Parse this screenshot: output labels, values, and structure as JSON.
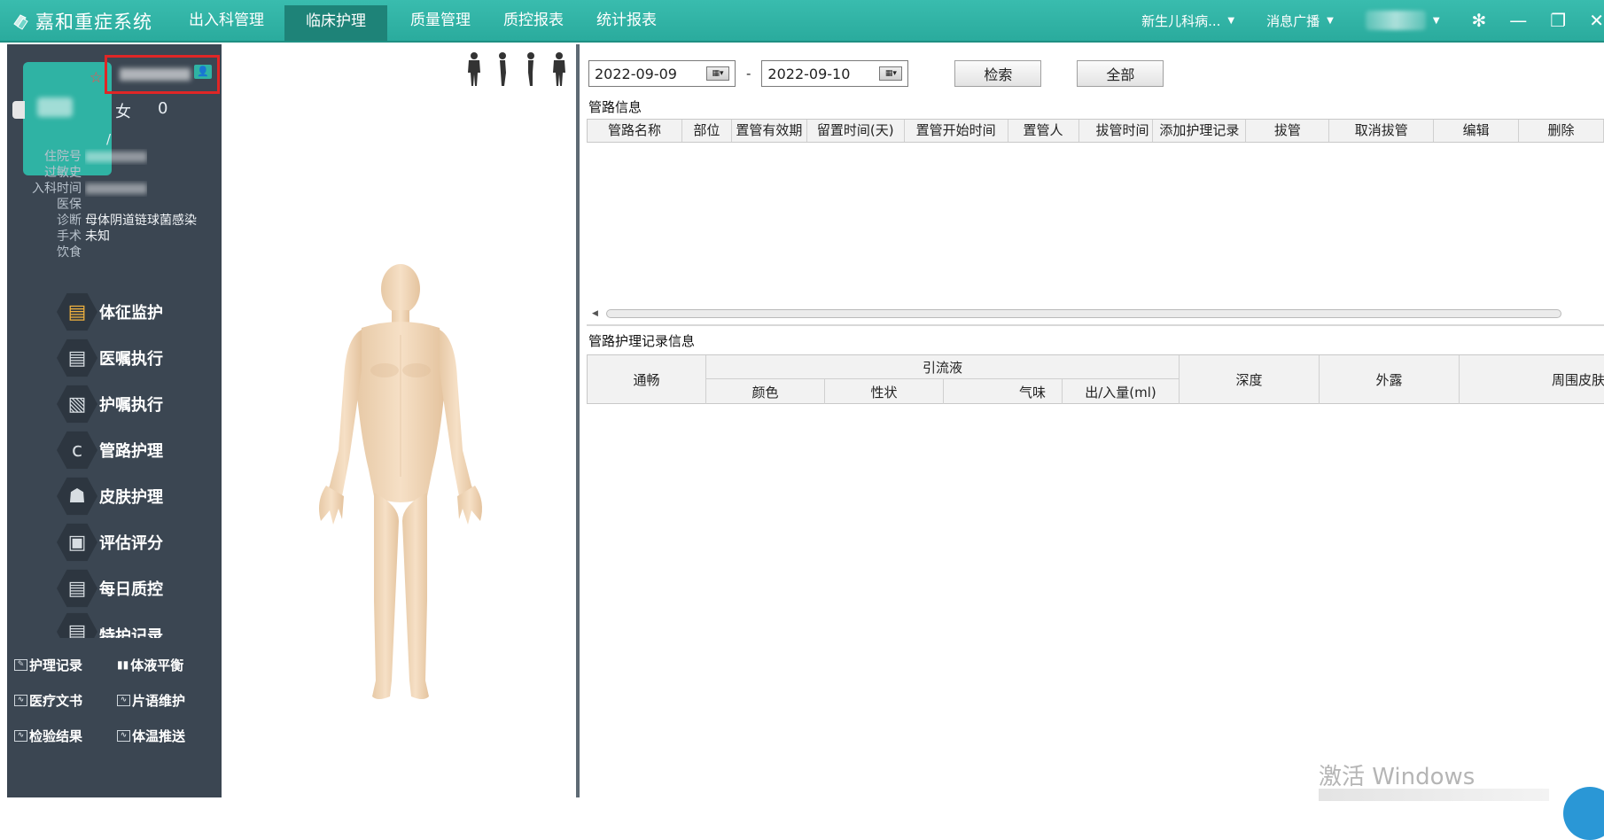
{
  "app": {
    "title": "嘉和重症系统",
    "icon": "logo-icon"
  },
  "nav": {
    "items": [
      {
        "label": "出入科管理"
      },
      {
        "label": "临床护理",
        "active": true
      },
      {
        "label": "质量管理"
      },
      {
        "label": "质控报表"
      },
      {
        "label": "统计报表"
      }
    ]
  },
  "topright": {
    "ward": "新生儿科病...",
    "broadcast": "消息广播",
    "settings_icon": "gear-icon",
    "minimize_icon": "minimize-icon",
    "restore_icon": "restore-icon",
    "close_icon": "close-icon"
  },
  "patient": {
    "gender": "女",
    "age": "0",
    "slash": "/",
    "fields": [
      {
        "label": "住院号",
        "value": ""
      },
      {
        "label": "过敏史",
        "value": ""
      },
      {
        "label": "入科时间",
        "value": ""
      },
      {
        "label": "医保",
        "value": ""
      },
      {
        "label": "诊断",
        "value": "母体阴道链球菌感染"
      },
      {
        "label": "手术",
        "value": "未知"
      },
      {
        "label": "饮食",
        "value": ""
      }
    ]
  },
  "sidebar_menu": [
    {
      "label": "体征监护",
      "icon": "vitals-icon",
      "active": true
    },
    {
      "label": "医嘱执行",
      "icon": "doctor-order-icon"
    },
    {
      "label": "护嘱执行",
      "icon": "nurse-order-icon"
    },
    {
      "label": "管路护理",
      "icon": "tube-icon"
    },
    {
      "label": "皮肤护理",
      "icon": "skin-icon"
    },
    {
      "label": "评估评分",
      "icon": "assessment-icon"
    },
    {
      "label": "每日质控",
      "icon": "daily-qc-icon"
    },
    {
      "label": "特护记录",
      "icon": "special-record-icon"
    }
  ],
  "bottom_links": [
    {
      "label": "护理记录",
      "icon": "edit-icon"
    },
    {
      "label": "体液平衡",
      "icon": "balance-icon"
    },
    {
      "label": "医疗文书",
      "icon": "document-icon"
    },
    {
      "label": "片语维护",
      "icon": "phrase-icon"
    },
    {
      "label": "检验结果",
      "icon": "lab-icon"
    },
    {
      "label": "体温推送",
      "icon": "temperature-icon"
    }
  ],
  "filter": {
    "start_date": "2022-09-09",
    "end_date": "2022-09-10",
    "separator": "-",
    "search_label": "检索",
    "all_label": "全部"
  },
  "tube_section": {
    "title": "管路信息",
    "columns": [
      "管路名称",
      "部位",
      "置管有效期",
      "留置时间(天)",
      "置管开始时间",
      "置管人",
      "拔管时间",
      "添加护理记录",
      "拔管",
      "取消拔管",
      "编辑",
      "删除"
    ]
  },
  "record_section": {
    "title": "管路护理记录信息",
    "col_smooth": "通畅",
    "col_drainage": "引流液",
    "sub_color": "颜色",
    "sub_nature": "性状",
    "sub_smell": "气味",
    "sub_volume": "出/入量(ml)",
    "col_depth": "深度",
    "col_exposed": "外露",
    "col_skin": "周围皮肤"
  },
  "watermark": {
    "text": "激活 Windows"
  },
  "colors": {
    "topbar": "#2aab9d",
    "sidebar": "#3b4652",
    "highlight_box": "#e02626"
  }
}
